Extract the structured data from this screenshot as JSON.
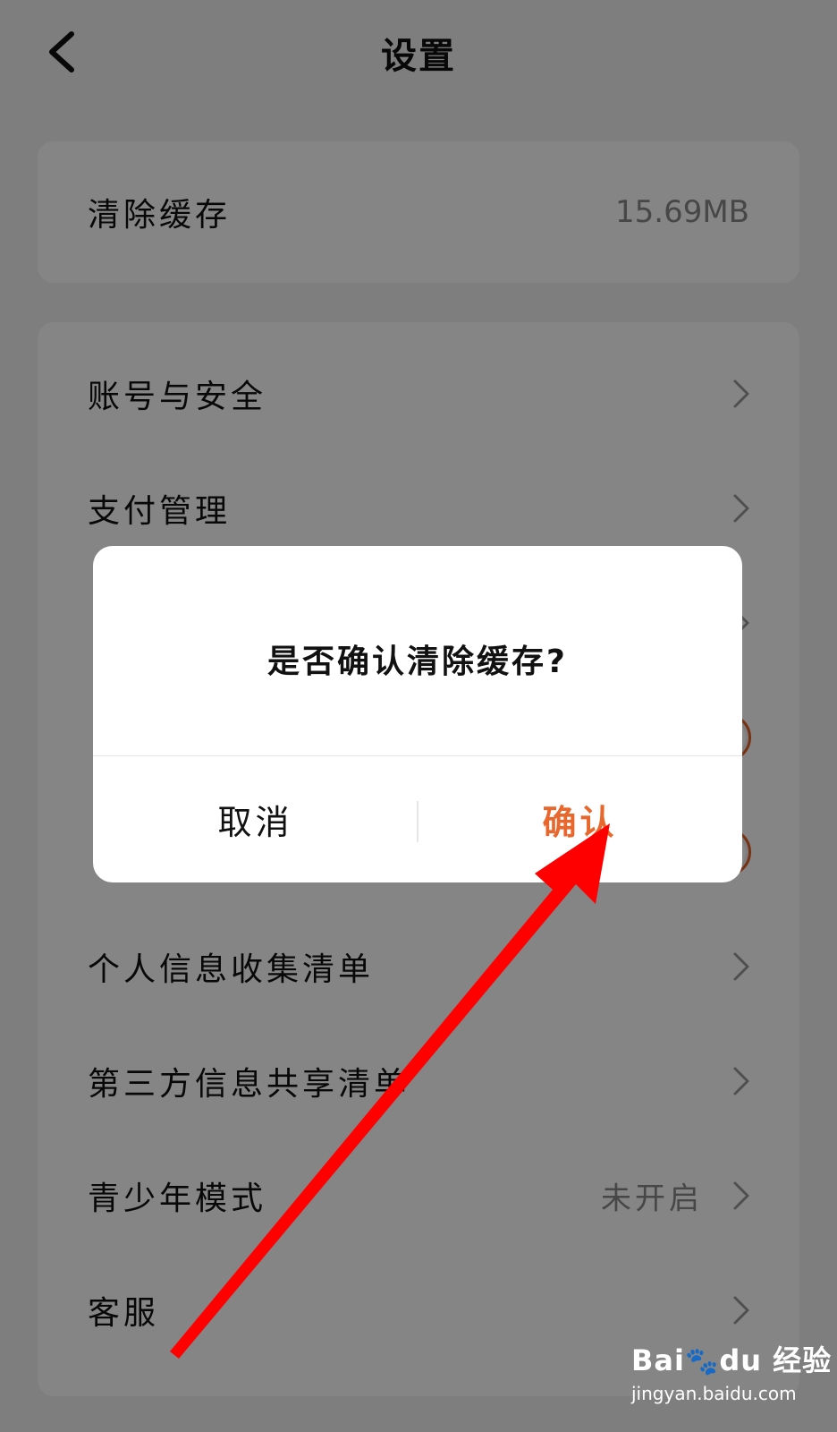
{
  "header": {
    "title": "设置",
    "back_icon": "chevron-left-icon"
  },
  "cache": {
    "label": "清除缓存",
    "value": "15.69MB"
  },
  "settings": {
    "items": [
      {
        "label": "账号与安全",
        "control": "chevron"
      },
      {
        "label": "支付管理",
        "control": "chevron"
      },
      {
        "label": "",
        "control": "chevron"
      },
      {
        "label": "",
        "control": "toggle"
      },
      {
        "label": "",
        "control": "toggle"
      },
      {
        "label": "个人信息收集清单",
        "control": "chevron"
      },
      {
        "label": "第三方信息共享清单",
        "control": "chevron"
      },
      {
        "label": "青少年模式",
        "value": "未开启",
        "control": "chevron"
      },
      {
        "label": "客服",
        "control": "chevron"
      }
    ]
  },
  "dialog": {
    "title": "是否确认清除缓存?",
    "cancel_label": "取消",
    "confirm_label": "确认"
  },
  "colors": {
    "accent": "#e8672c",
    "annotation_arrow": "#ff0000",
    "overlay": "rgba(0,0,0,0.48)"
  },
  "watermark": {
    "logo": "Bai百度经验",
    "url": "jingyan.baidu.com"
  }
}
